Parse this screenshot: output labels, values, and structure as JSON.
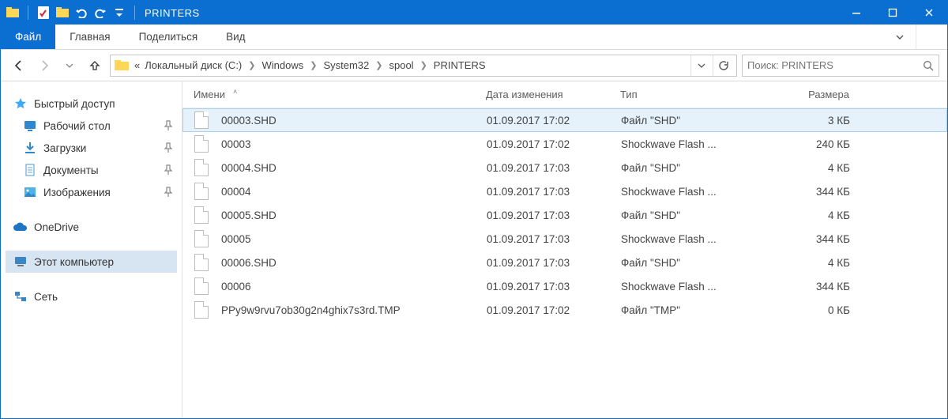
{
  "titlebar": {
    "title": "PRINTERS"
  },
  "ribbon": {
    "file": "Файл",
    "tabs": [
      "Главная",
      "Поделиться",
      "Вид"
    ]
  },
  "nav": {
    "breadcrumb_prefix": "«",
    "crumbs": [
      "Локальный диск (C:)",
      "Windows",
      "System32",
      "spool",
      "PRINTERS"
    ],
    "search_placeholder": "Поиск: PRINTERS"
  },
  "navpane": {
    "quick_access": {
      "label": "Быстрый доступ",
      "items": [
        {
          "label": "Рабочий стол",
          "icon": "desktop"
        },
        {
          "label": "Загрузки",
          "icon": "downloads"
        },
        {
          "label": "Документы",
          "icon": "documents"
        },
        {
          "label": "Изображения",
          "icon": "pictures"
        }
      ]
    },
    "onedrive": {
      "label": "OneDrive"
    },
    "this_pc": {
      "label": "Этот компьютер"
    },
    "network": {
      "label": "Сеть"
    }
  },
  "columns": {
    "name": "Имени",
    "date": "Дата изменения",
    "type": "Тип",
    "size": "Размера"
  },
  "files": [
    {
      "name": "00003.SHD",
      "date": "01.09.2017 17:02",
      "type": "Файл \"SHD\"",
      "size": "3 КБ",
      "selected": true
    },
    {
      "name": "00003",
      "date": "01.09.2017 17:02",
      "type": "Shockwave Flash ...",
      "size": "240 КБ",
      "selected": false
    },
    {
      "name": "00004.SHD",
      "date": "01.09.2017 17:03",
      "type": "Файл \"SHD\"",
      "size": "4 КБ",
      "selected": false
    },
    {
      "name": "00004",
      "date": "01.09.2017 17:03",
      "type": "Shockwave Flash ...",
      "size": "344 КБ",
      "selected": false
    },
    {
      "name": "00005.SHD",
      "date": "01.09.2017 17:03",
      "type": "Файл \"SHD\"",
      "size": "4 КБ",
      "selected": false
    },
    {
      "name": "00005",
      "date": "01.09.2017 17:03",
      "type": "Shockwave Flash ...",
      "size": "344 КБ",
      "selected": false
    },
    {
      "name": "00006.SHD",
      "date": "01.09.2017 17:03",
      "type": "Файл \"SHD\"",
      "size": "4 КБ",
      "selected": false
    },
    {
      "name": "00006",
      "date": "01.09.2017 17:03",
      "type": "Shockwave Flash ...",
      "size": "344 КБ",
      "selected": false
    },
    {
      "name": "PPy9w9rvu7ob30g2n4ghix7s3rd.TMP",
      "date": "01.09.2017 17:02",
      "type": "Файл \"TMP\"",
      "size": "0 КБ",
      "selected": false
    }
  ]
}
